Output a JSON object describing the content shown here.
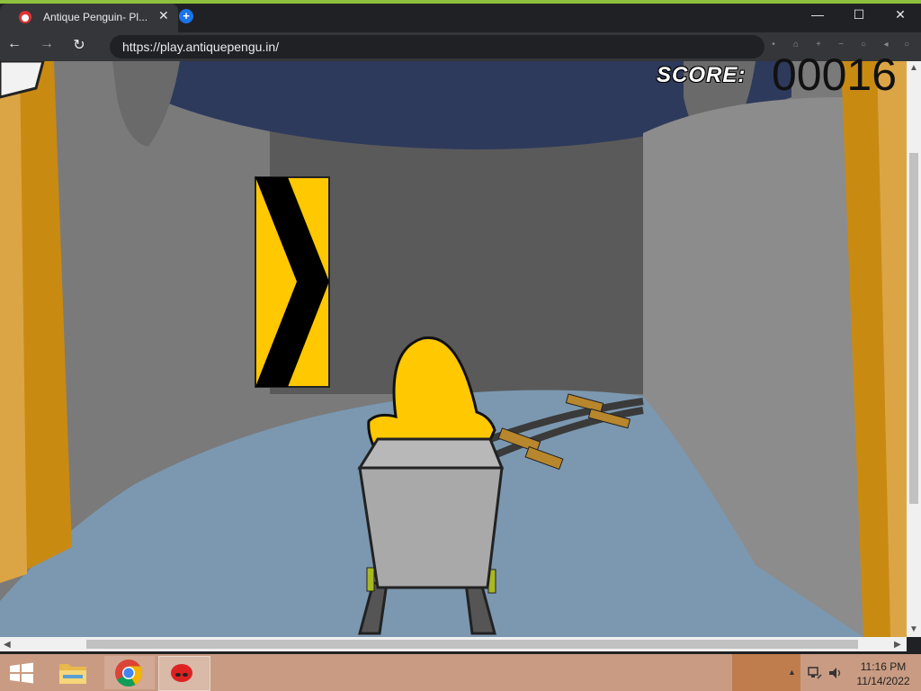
{
  "browser": {
    "tab_title": "Antique Penguin- Pl...",
    "tab_close": "✕",
    "new_tab": "+",
    "url": "https://play.antiquepengu.in/",
    "nav": {
      "back": "←",
      "forward": "→",
      "reload": "↻"
    },
    "window_controls": {
      "minimize": "—",
      "maximize": "☐",
      "close": "✕"
    },
    "extensions": [
      "•",
      "⌂",
      "+",
      "−",
      "○",
      "◂",
      "○"
    ]
  },
  "game": {
    "score_label": "SCORE:",
    "score_value": "00016",
    "colors": {
      "ceiling": "#2e3a5c",
      "wall": "#7a7a7a",
      "floor": "#7b98b0",
      "pillar": "#c98a12",
      "sign_yellow": "#ffc800",
      "penguin_yellow": "#ffc800",
      "cart": "#a9a9a9",
      "rail_tie": "#b8862c"
    }
  },
  "scrollbars": {
    "left_arrow": "◀",
    "right_arrow": "▶",
    "up_arrow": "▲",
    "down_arrow": "▼"
  },
  "taskbar": {
    "time": "11:16 PM",
    "date": "11/14/2022",
    "tray_up": "▲",
    "icons": [
      "windows-start-icon",
      "file-explorer-icon",
      "chrome-icon",
      "penguin-app-icon"
    ]
  }
}
